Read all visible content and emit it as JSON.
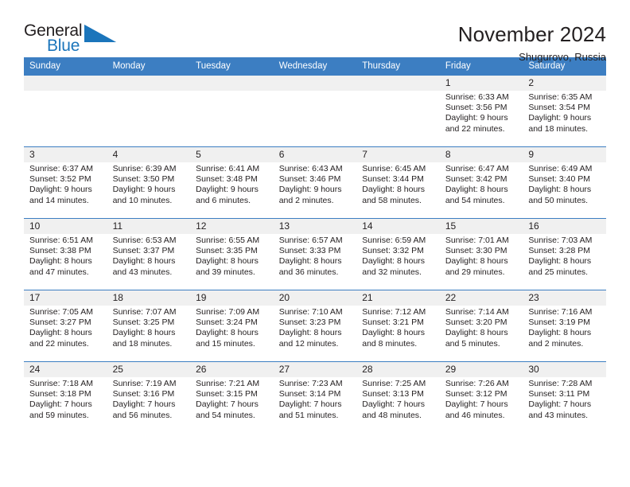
{
  "brand": {
    "name_part1": "General",
    "name_part2": "Blue",
    "accent_color": "#1b75bb"
  },
  "header": {
    "title": "November 2024",
    "location": "Shugurovo, Russia",
    "header_bg_color": "#3c7ec2"
  },
  "weekdays": [
    "Sunday",
    "Monday",
    "Tuesday",
    "Wednesday",
    "Thursday",
    "Friday",
    "Saturday"
  ],
  "weeks": [
    [
      {
        "day": ""
      },
      {
        "day": ""
      },
      {
        "day": ""
      },
      {
        "day": ""
      },
      {
        "day": ""
      },
      {
        "day": "1",
        "sunrise": "Sunrise: 6:33 AM",
        "sunset": "Sunset: 3:56 PM",
        "daylight1": "Daylight: 9 hours",
        "daylight2": "and 22 minutes."
      },
      {
        "day": "2",
        "sunrise": "Sunrise: 6:35 AM",
        "sunset": "Sunset: 3:54 PM",
        "daylight1": "Daylight: 9 hours",
        "daylight2": "and 18 minutes."
      }
    ],
    [
      {
        "day": "3",
        "sunrise": "Sunrise: 6:37 AM",
        "sunset": "Sunset: 3:52 PM",
        "daylight1": "Daylight: 9 hours",
        "daylight2": "and 14 minutes."
      },
      {
        "day": "4",
        "sunrise": "Sunrise: 6:39 AM",
        "sunset": "Sunset: 3:50 PM",
        "daylight1": "Daylight: 9 hours",
        "daylight2": "and 10 minutes."
      },
      {
        "day": "5",
        "sunrise": "Sunrise: 6:41 AM",
        "sunset": "Sunset: 3:48 PM",
        "daylight1": "Daylight: 9 hours",
        "daylight2": "and 6 minutes."
      },
      {
        "day": "6",
        "sunrise": "Sunrise: 6:43 AM",
        "sunset": "Sunset: 3:46 PM",
        "daylight1": "Daylight: 9 hours",
        "daylight2": "and 2 minutes."
      },
      {
        "day": "7",
        "sunrise": "Sunrise: 6:45 AM",
        "sunset": "Sunset: 3:44 PM",
        "daylight1": "Daylight: 8 hours",
        "daylight2": "and 58 minutes."
      },
      {
        "day": "8",
        "sunrise": "Sunrise: 6:47 AM",
        "sunset": "Sunset: 3:42 PM",
        "daylight1": "Daylight: 8 hours",
        "daylight2": "and 54 minutes."
      },
      {
        "day": "9",
        "sunrise": "Sunrise: 6:49 AM",
        "sunset": "Sunset: 3:40 PM",
        "daylight1": "Daylight: 8 hours",
        "daylight2": "and 50 minutes."
      }
    ],
    [
      {
        "day": "10",
        "sunrise": "Sunrise: 6:51 AM",
        "sunset": "Sunset: 3:38 PM",
        "daylight1": "Daylight: 8 hours",
        "daylight2": "and 47 minutes."
      },
      {
        "day": "11",
        "sunrise": "Sunrise: 6:53 AM",
        "sunset": "Sunset: 3:37 PM",
        "daylight1": "Daylight: 8 hours",
        "daylight2": "and 43 minutes."
      },
      {
        "day": "12",
        "sunrise": "Sunrise: 6:55 AM",
        "sunset": "Sunset: 3:35 PM",
        "daylight1": "Daylight: 8 hours",
        "daylight2": "and 39 minutes."
      },
      {
        "day": "13",
        "sunrise": "Sunrise: 6:57 AM",
        "sunset": "Sunset: 3:33 PM",
        "daylight1": "Daylight: 8 hours",
        "daylight2": "and 36 minutes."
      },
      {
        "day": "14",
        "sunrise": "Sunrise: 6:59 AM",
        "sunset": "Sunset: 3:32 PM",
        "daylight1": "Daylight: 8 hours",
        "daylight2": "and 32 minutes."
      },
      {
        "day": "15",
        "sunrise": "Sunrise: 7:01 AM",
        "sunset": "Sunset: 3:30 PM",
        "daylight1": "Daylight: 8 hours",
        "daylight2": "and 29 minutes."
      },
      {
        "day": "16",
        "sunrise": "Sunrise: 7:03 AM",
        "sunset": "Sunset: 3:28 PM",
        "daylight1": "Daylight: 8 hours",
        "daylight2": "and 25 minutes."
      }
    ],
    [
      {
        "day": "17",
        "sunrise": "Sunrise: 7:05 AM",
        "sunset": "Sunset: 3:27 PM",
        "daylight1": "Daylight: 8 hours",
        "daylight2": "and 22 minutes."
      },
      {
        "day": "18",
        "sunrise": "Sunrise: 7:07 AM",
        "sunset": "Sunset: 3:25 PM",
        "daylight1": "Daylight: 8 hours",
        "daylight2": "and 18 minutes."
      },
      {
        "day": "19",
        "sunrise": "Sunrise: 7:09 AM",
        "sunset": "Sunset: 3:24 PM",
        "daylight1": "Daylight: 8 hours",
        "daylight2": "and 15 minutes."
      },
      {
        "day": "20",
        "sunrise": "Sunrise: 7:10 AM",
        "sunset": "Sunset: 3:23 PM",
        "daylight1": "Daylight: 8 hours",
        "daylight2": "and 12 minutes."
      },
      {
        "day": "21",
        "sunrise": "Sunrise: 7:12 AM",
        "sunset": "Sunset: 3:21 PM",
        "daylight1": "Daylight: 8 hours",
        "daylight2": "and 8 minutes."
      },
      {
        "day": "22",
        "sunrise": "Sunrise: 7:14 AM",
        "sunset": "Sunset: 3:20 PM",
        "daylight1": "Daylight: 8 hours",
        "daylight2": "and 5 minutes."
      },
      {
        "day": "23",
        "sunrise": "Sunrise: 7:16 AM",
        "sunset": "Sunset: 3:19 PM",
        "daylight1": "Daylight: 8 hours",
        "daylight2": "and 2 minutes."
      }
    ],
    [
      {
        "day": "24",
        "sunrise": "Sunrise: 7:18 AM",
        "sunset": "Sunset: 3:18 PM",
        "daylight1": "Daylight: 7 hours",
        "daylight2": "and 59 minutes."
      },
      {
        "day": "25",
        "sunrise": "Sunrise: 7:19 AM",
        "sunset": "Sunset: 3:16 PM",
        "daylight1": "Daylight: 7 hours",
        "daylight2": "and 56 minutes."
      },
      {
        "day": "26",
        "sunrise": "Sunrise: 7:21 AM",
        "sunset": "Sunset: 3:15 PM",
        "daylight1": "Daylight: 7 hours",
        "daylight2": "and 54 minutes."
      },
      {
        "day": "27",
        "sunrise": "Sunrise: 7:23 AM",
        "sunset": "Sunset: 3:14 PM",
        "daylight1": "Daylight: 7 hours",
        "daylight2": "and 51 minutes."
      },
      {
        "day": "28",
        "sunrise": "Sunrise: 7:25 AM",
        "sunset": "Sunset: 3:13 PM",
        "daylight1": "Daylight: 7 hours",
        "daylight2": "and 48 minutes."
      },
      {
        "day": "29",
        "sunrise": "Sunrise: 7:26 AM",
        "sunset": "Sunset: 3:12 PM",
        "daylight1": "Daylight: 7 hours",
        "daylight2": "and 46 minutes."
      },
      {
        "day": "30",
        "sunrise": "Sunrise: 7:28 AM",
        "sunset": "Sunset: 3:11 PM",
        "daylight1": "Daylight: 7 hours",
        "daylight2": "and 43 minutes."
      }
    ]
  ]
}
